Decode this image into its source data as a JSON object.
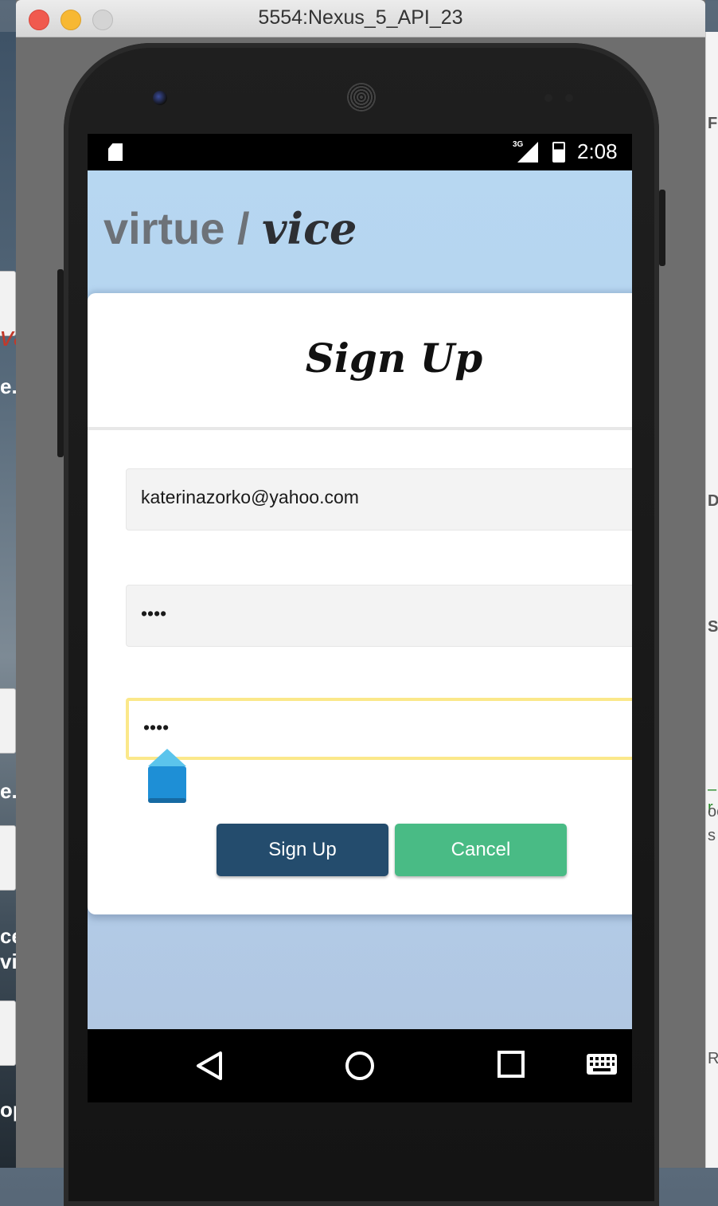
{
  "window": {
    "title": "5554:Nexus_5_API_23",
    "traffic_lights": {
      "close": "#f05a4e",
      "minimize": "#f7b833",
      "maximize": "#c9c9c9"
    }
  },
  "desktop": {
    "left_fragments": [
      "va",
      "e.j",
      "e.p",
      "ce",
      "vi",
      "op"
    ],
    "right_fragments": [
      "F",
      "D",
      "S",
      "–r",
      "oc",
      "s",
      "Ru"
    ]
  },
  "status_bar": {
    "network": "3G",
    "time": "2:08"
  },
  "app": {
    "logo_left": "virtue / ",
    "logo_right": "vice",
    "card_title": "Sign Up",
    "email_value": "katerinazorko@yahoo.com",
    "password_value": "••••",
    "confirm_value": "••••",
    "signup_label": "Sign Up",
    "cancel_label": "Cancel",
    "colors": {
      "header_bg": "#b7d7f1",
      "signup_btn": "#244c6d",
      "cancel_btn": "#49bb85",
      "focus_border": "#fbe88a"
    }
  },
  "nav_bar": {
    "icons": [
      "back-icon",
      "home-icon",
      "recents-icon",
      "keyboard-icon"
    ]
  }
}
